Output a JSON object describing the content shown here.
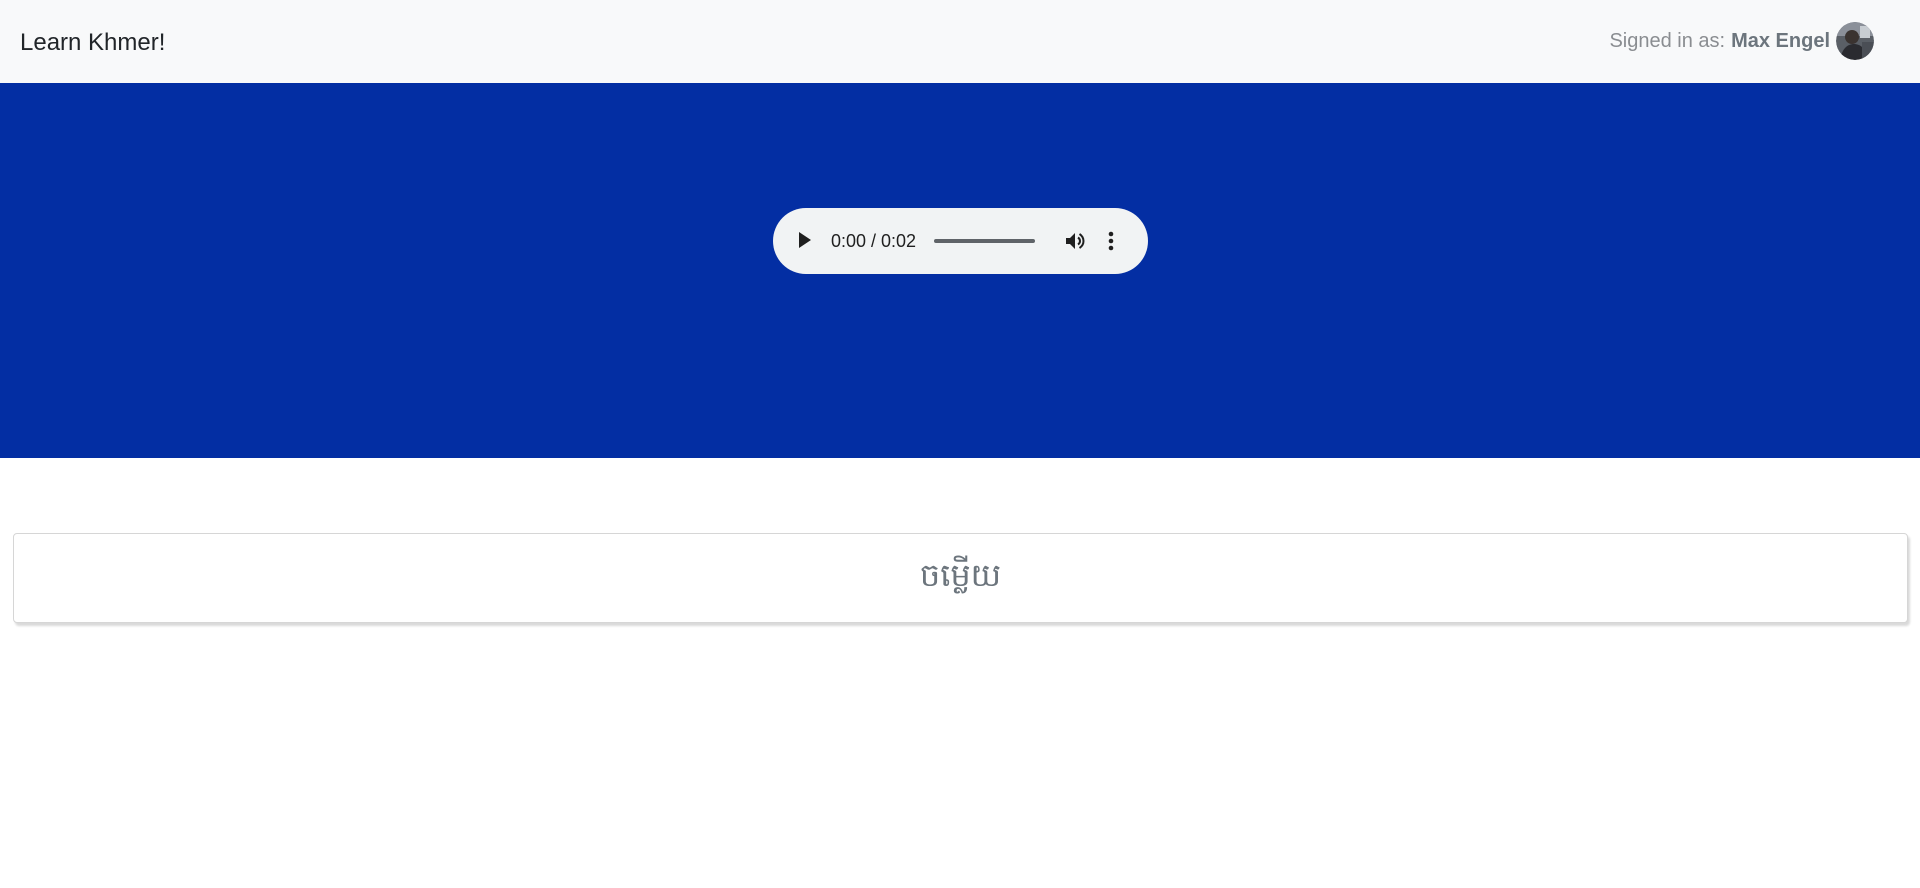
{
  "navbar": {
    "brand": "Learn Khmer!",
    "signed_in_prefix": "Signed in as:",
    "username": "Max Engel",
    "avatar_icon": "user-avatar"
  },
  "hero": {
    "background_color": "#032ea3"
  },
  "audio": {
    "time": "0:00 / 0:02",
    "play_icon": "play-icon",
    "volume_icon": "volume-icon",
    "menu_icon": "more-vertical-icon",
    "progress": 0
  },
  "answer_card": {
    "text": "ចម្លើយ"
  }
}
